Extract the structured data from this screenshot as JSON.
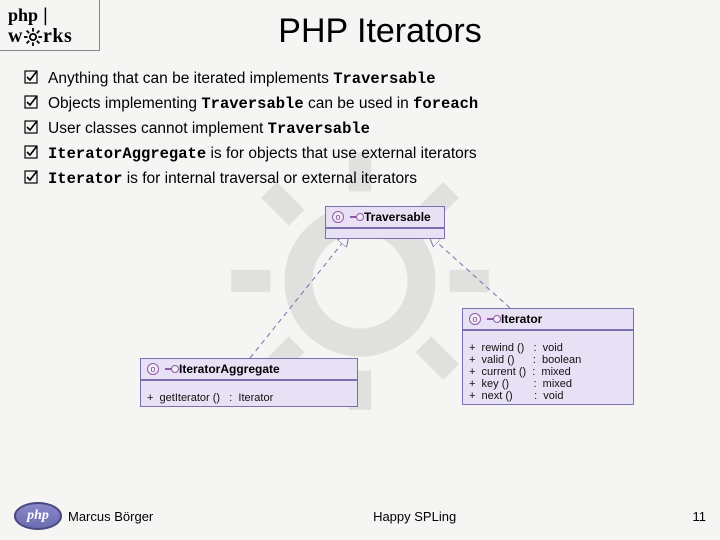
{
  "header": {
    "logo_top": "php",
    "logo_bottom_left": "w",
    "logo_bottom_right": "rks",
    "title": "PHP Iterators"
  },
  "bullets": [
    {
      "pre": "Anything that can be iterated implements ",
      "code1": "Traversable",
      "mid": "",
      "code2": "",
      "post": ""
    },
    {
      "pre": "Objects implementing ",
      "code1": "Traversable",
      "mid": " can be used in ",
      "code2": "foreach",
      "post": ""
    },
    {
      "pre": "User classes cannot implement ",
      "code1": "Traversable",
      "mid": "",
      "code2": "",
      "post": ""
    },
    {
      "pre": "",
      "code1": "IteratorAggregate",
      "mid": " is for objects that use external iterators",
      "code2": "",
      "post": ""
    },
    {
      "pre": "",
      "code1": "Iterator",
      "mid": " is for internal traversal or external iterators",
      "code2": "",
      "post": ""
    }
  ],
  "uml": {
    "traversable": {
      "name": "Traversable"
    },
    "iteragg": {
      "name": "IteratorAggregate",
      "ops": [
        "+  getIterator ()   :  Iterator"
      ]
    },
    "iterator": {
      "name": "Iterator",
      "ops": [
        "+  rewind ()   :  void",
        "+  valid ()      :  boolean",
        "+  current ()  :  mixed",
        "+  key ()        :  mixed",
        "+  next ()       :  void"
      ]
    }
  },
  "footer": {
    "logo_text": "php",
    "author": "Marcus Börger",
    "center": "Happy SPLing",
    "page": "11"
  }
}
